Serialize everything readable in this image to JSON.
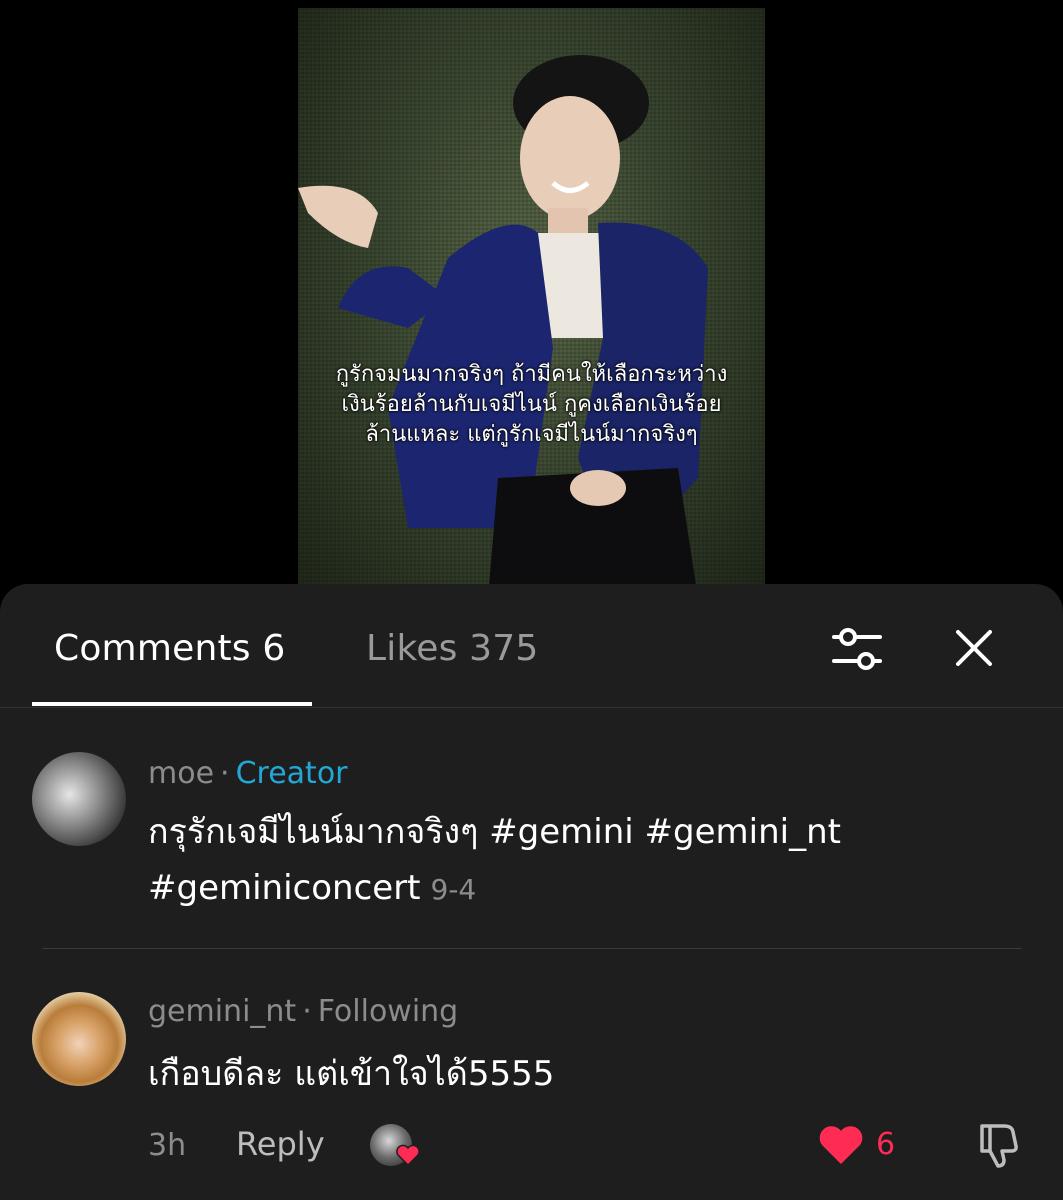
{
  "video": {
    "caption_lines": [
      "กูรักจมนมากจริงๆ ถ้ามีคนให้เลือกระหว่าง",
      "เงินร้อยล้านกับเจมีไนน์ กูคงเลือกเงินร้อย",
      "ล้านแหละ แต่กูรักเจมีไนน์มากจริงๆ"
    ]
  },
  "tabs": {
    "comments_label": "Comments 6",
    "likes_label": "Likes 375"
  },
  "comments": [
    {
      "username": "moe",
      "separator": "·",
      "badge": "Creator",
      "text": "กรุรักเจมีไนน์มากจริงๆ #gemini #gemini_nt #geminiconcert",
      "date": "9-4"
    },
    {
      "username": "gemini_nt",
      "separator": "·",
      "badge": "Following",
      "text": "เกือบดีละ แต่เข้าใจได้5555",
      "time": "3h",
      "reply_label": "Reply",
      "like_count": "6"
    }
  ],
  "icons": {
    "filter": "sliders-icon",
    "close": "close-icon",
    "heart": "heart-icon",
    "dislike": "thumbs-down-icon"
  },
  "colors": {
    "accent_creator": "#23a7d6",
    "like": "#fe2c55",
    "sheet_bg": "#1e1e1e"
  }
}
